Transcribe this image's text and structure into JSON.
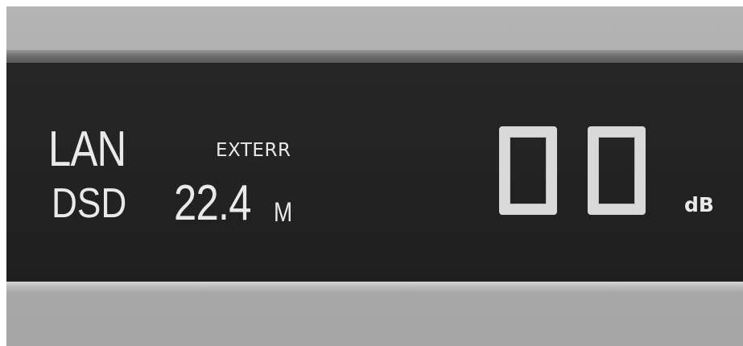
{
  "display": {
    "source": "LAN",
    "indicator": "EXTERR",
    "format": "DSD",
    "sample_rate": "22.4",
    "sample_rate_unit": "M",
    "volume_digits": [
      "0",
      "0"
    ],
    "volume_unit": "dB"
  }
}
